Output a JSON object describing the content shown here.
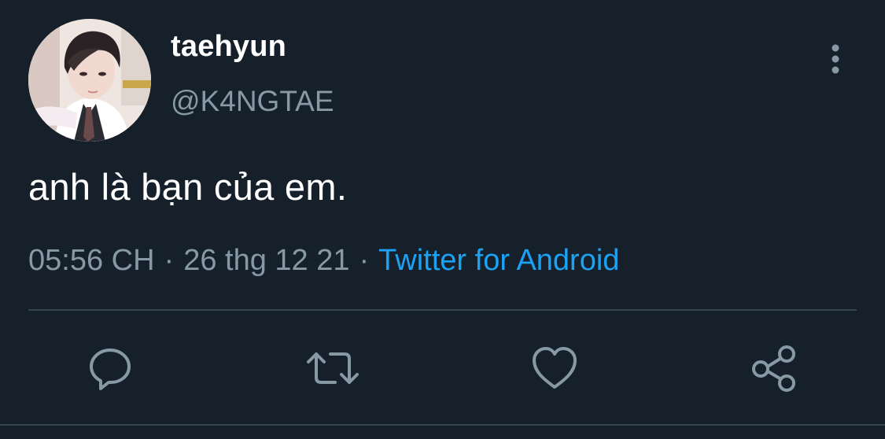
{
  "tweet": {
    "display_name": "taehyun",
    "handle": "@K4NGTAE",
    "text": "anh là bạn của em.",
    "time": "05:56 CH",
    "separator": "·",
    "date": "26 thg 12 21",
    "source": "Twitter for Android"
  },
  "icons": {
    "more": "more-vertical-icon",
    "reply": "reply-icon",
    "retweet": "retweet-icon",
    "like": "heart-icon",
    "share": "share-icon"
  },
  "colors": {
    "background": "#15202b",
    "primary_text": "#ffffff",
    "secondary_text": "#8899a6",
    "link": "#1da1f2",
    "divider": "#38444d"
  }
}
